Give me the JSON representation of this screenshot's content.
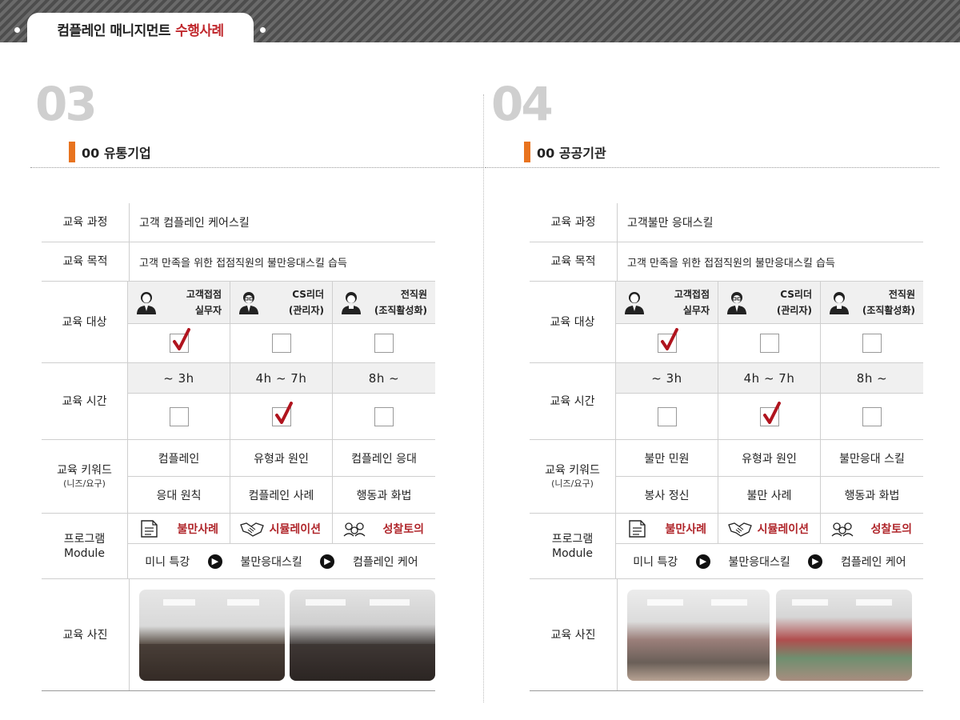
{
  "header": {
    "title_main": "컴플레인 매니지먼트",
    "title_accent": "수행사례"
  },
  "sections": [
    {
      "number": "03",
      "org": "00 유통기업",
      "course_label": "교육 과정",
      "course": "고객 컴플레인 케어스킬",
      "purpose_label": "교육 목적",
      "purpose": "고객 만족을 위한 접점직원의 불만응대스킬 습득",
      "target_label": "교육 대상",
      "targets": [
        {
          "line1": "고객접점",
          "line2": "실무자",
          "checked": true
        },
        {
          "line1": "CS리더",
          "line2": "(관리자)",
          "checked": false
        },
        {
          "line1": "전직원",
          "line2": "(조직활성화)",
          "checked": false
        }
      ],
      "time_label": "교육 시간",
      "times": [
        {
          "label": "~ 3h",
          "checked": false
        },
        {
          "label": "4h ~ 7h",
          "checked": true
        },
        {
          "label": "8h ~",
          "checked": false
        }
      ],
      "keyword_label": "교육 키워드",
      "keyword_sub": "(니즈/요구)",
      "keywords": [
        "컴플레인",
        "유형과 원인",
        "컴플레인 응대",
        "응대 원칙",
        "컴플레인 사례",
        "행동과 화법"
      ],
      "program_label": "프로그램",
      "program_sub": "Module",
      "programs": [
        "불만사례",
        "시뮬레이션",
        "성찰토의"
      ],
      "flow": [
        "미니 특강",
        "불만응대스킬",
        "컴플레인 케어"
      ],
      "photo_label": "교육 사진"
    },
    {
      "number": "04",
      "org": "00 공공기관",
      "course_label": "교육 과정",
      "course": "고객불만 응대스킬",
      "purpose_label": "교육 목적",
      "purpose": "고객 만족을 위한 접점직원의 불만응대스킬 습득",
      "target_label": "교육 대상",
      "targets": [
        {
          "line1": "고객접점",
          "line2": "실무자",
          "checked": true
        },
        {
          "line1": "CS리더",
          "line2": "(관리자)",
          "checked": false
        },
        {
          "line1": "전직원",
          "line2": "(조직활성화)",
          "checked": false
        }
      ],
      "time_label": "교육 시간",
      "times": [
        {
          "label": "~ 3h",
          "checked": false
        },
        {
          "label": "4h ~ 7h",
          "checked": true
        },
        {
          "label": "8h ~",
          "checked": false
        }
      ],
      "keyword_label": "교육 키워드",
      "keyword_sub": "(니즈/요구)",
      "keywords": [
        "불만 민원",
        "유형과 원인",
        "불만응대 스킬",
        "봉사 정신",
        "불만 사례",
        "행동과 화법"
      ],
      "program_label": "프로그램",
      "program_sub": "Module",
      "programs": [
        "불만사례",
        "시뮬레이션",
        "성찰토의"
      ],
      "flow": [
        "미니 특강",
        "불만응대스킬",
        "컴플레인 케어"
      ],
      "photo_label": "교육 사진"
    }
  ],
  "colors": {
    "accent_red": "#c0282d",
    "program_red": "#b0262b",
    "title_bar_orange": "#e8731e",
    "check_red": "#b0141e"
  }
}
